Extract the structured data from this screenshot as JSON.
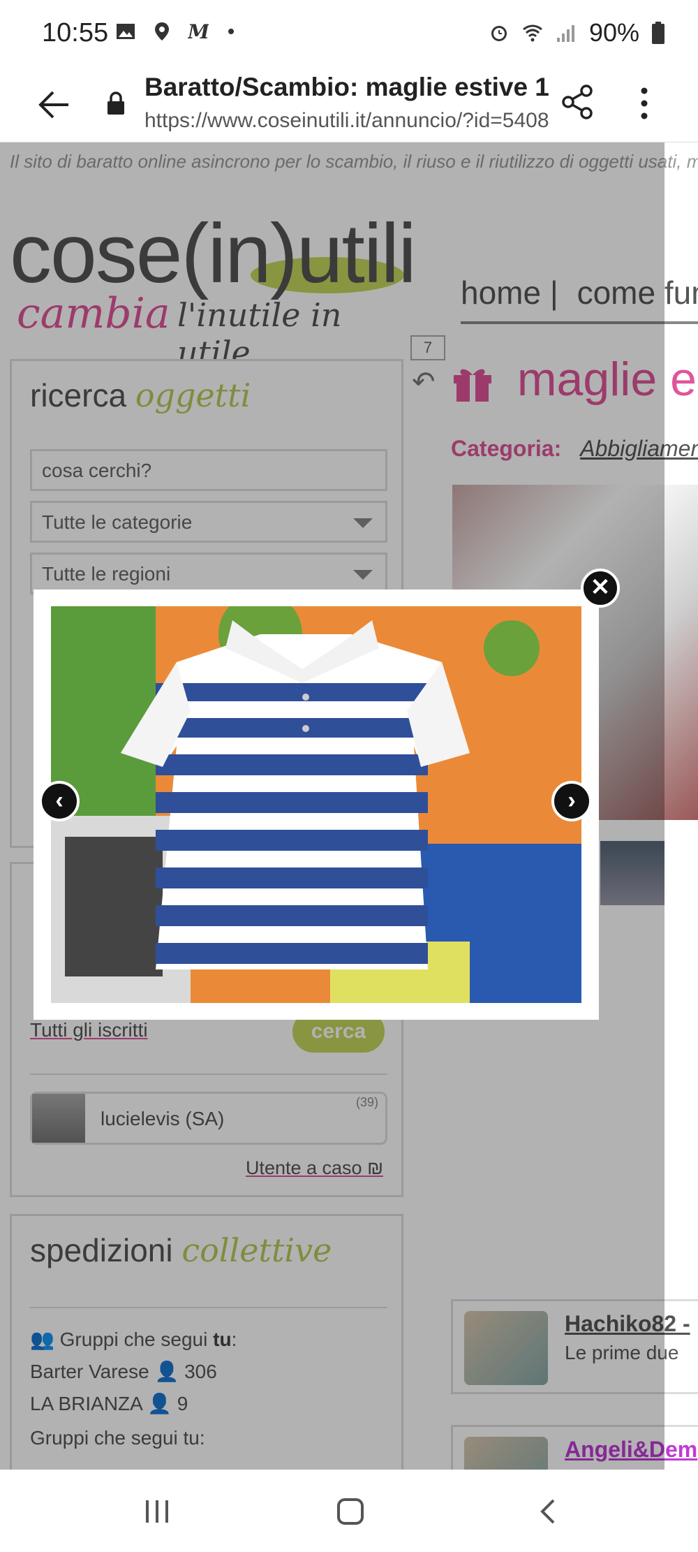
{
  "status_bar": {
    "time": "10:55",
    "battery": "90%"
  },
  "browser": {
    "title": "Baratto/Scambio: maglie estive 1...",
    "url": "https://www.coseinutili.it/annuncio/?id=5408..."
  },
  "site": {
    "tagline": "Il sito di baratto online asincrono per lo scambio, il riuso e il riutilizzo di oggetti usati, m",
    "logo_main": "cose(in)utili",
    "logo_cambia": "cambia",
    "logo_sub": "l'inutile in utile",
    "nav": [
      "home |",
      "come fun"
    ]
  },
  "item": {
    "counter": "7",
    "title": "maglie e",
    "category_label": "Categoria:",
    "category_value": "Abbigliamento"
  },
  "search": {
    "heading_plain": "ricerca",
    "heading_script": "oggetti",
    "query_placeholder": "cosa cerchi?",
    "category_select": "Tutte le categorie",
    "region_select": "Tutte le regioni"
  },
  "users": {
    "all_link": "Tutti gli iscritti",
    "search_button": "cerca",
    "user_name": "lucielevis (SA)",
    "user_count": "(39)",
    "random_link": "Utente a caso"
  },
  "shipping": {
    "heading_plain": "spedizioni",
    "heading_script": "collettive",
    "groups_label_prefix": "Gruppi che segui",
    "groups_label_bold": "tu",
    "groups_label_suffix": ":",
    "groups": [
      {
        "name": "Barter Varese",
        "members": "306"
      },
      {
        "name": "LA BRIANZA",
        "members": "9"
      }
    ],
    "groups_label_2": "Gruppi che segui tu:"
  },
  "comments": [
    {
      "name": "Hachiko82",
      "suffix": " -",
      "text": "Le prime due"
    },
    {
      "name": "Angeli&Dem",
      "suffix": "",
      "text": ""
    }
  ],
  "lightbox": {
    "close_icon": "close-icon",
    "prev_icon": "chevron-left-icon",
    "next_icon": "chevron-right-icon"
  },
  "colors": {
    "accent_pink": "#e0559a",
    "accent_green": "#c4d65c"
  }
}
